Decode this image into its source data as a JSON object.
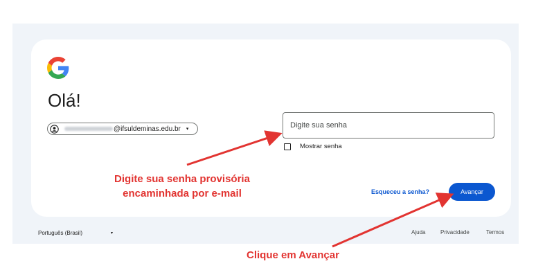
{
  "greeting": "Olá!",
  "account": {
    "email_domain": "@ifsuldeminas.edu.br",
    "caret": "▾"
  },
  "password": {
    "placeholder": "Digite sua senha",
    "show_label": "Mostrar senha"
  },
  "actions": {
    "forgot": "Esqueceu a senha?",
    "next": "Avançar"
  },
  "footer": {
    "language": "Português (Brasil)",
    "caret": "▾",
    "links": [
      "Ajuda",
      "Privacidade",
      "Termos"
    ]
  },
  "annotations": {
    "password_hint": "Digite sua senha provisória\nencaminhada por e-mail",
    "click_hint": "Clique em Avançar",
    "color": "#e23431"
  },
  "colors": {
    "primary": "#0b57d0",
    "background": "#f0f4f9",
    "card": "#ffffff"
  },
  "icons": {
    "logo": "google-logo",
    "avatar": "account-circle-icon",
    "checkbox": "checkbox-unchecked-icon"
  }
}
